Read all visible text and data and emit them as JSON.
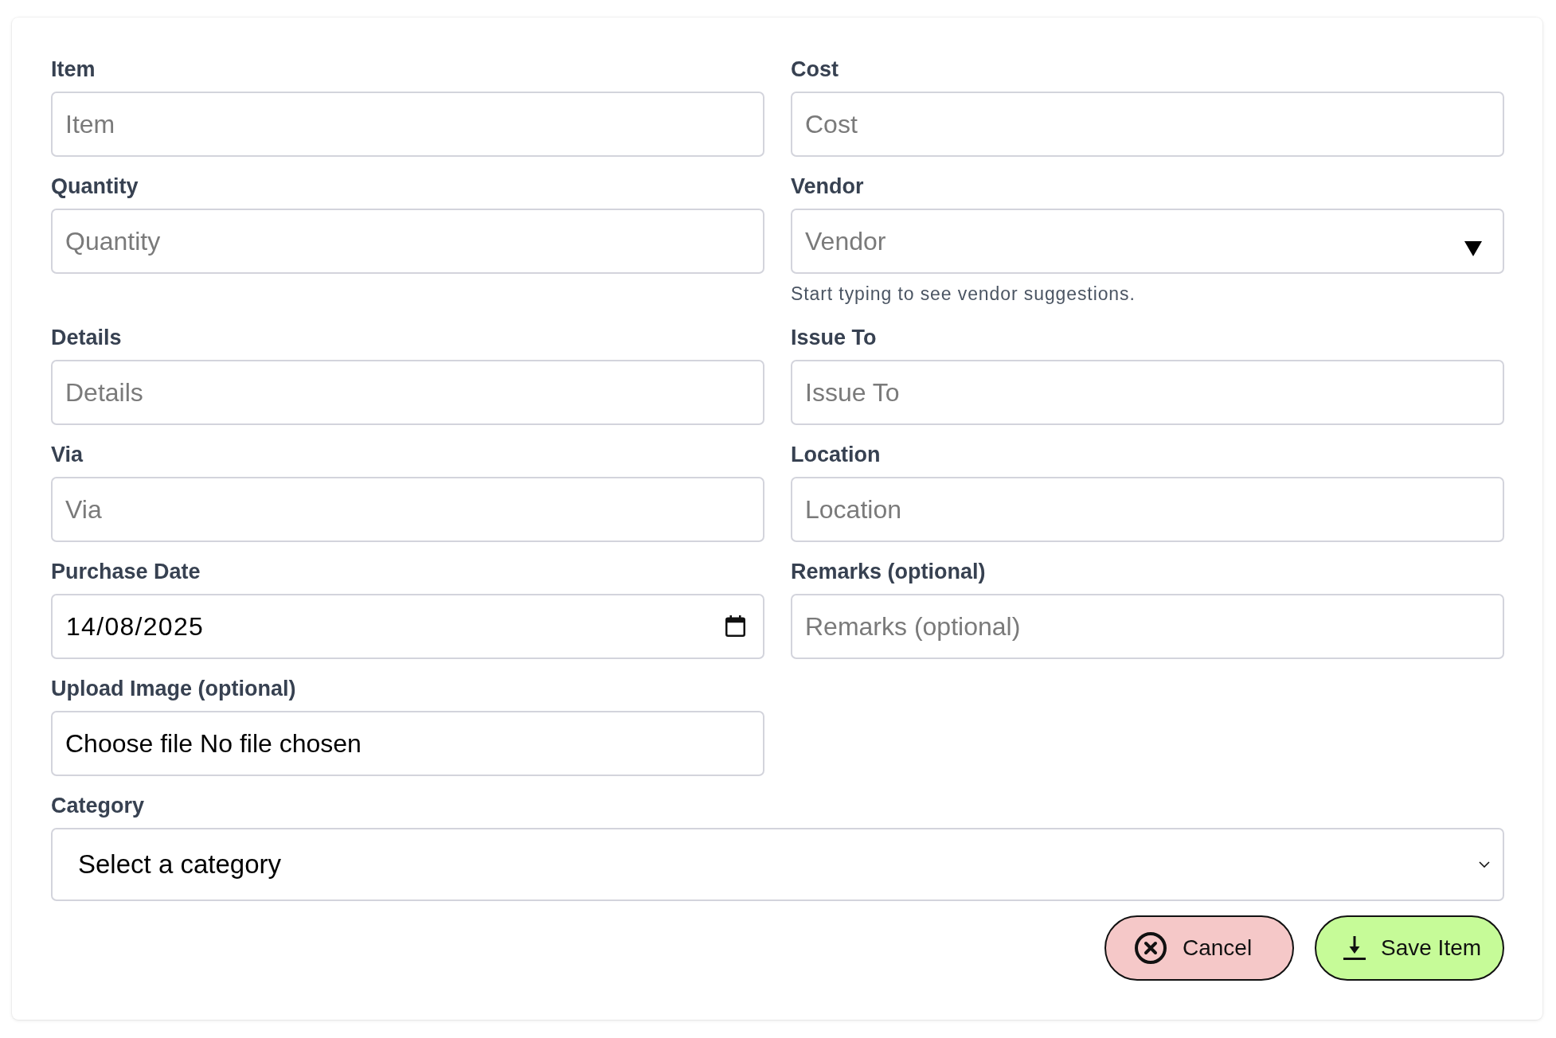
{
  "form": {
    "fields": [
      {
        "kind": "text",
        "label": "Item",
        "placeholder": "Item"
      },
      {
        "kind": "text",
        "label": "Cost",
        "placeholder": "Cost"
      },
      {
        "kind": "text",
        "label": "Quantity",
        "placeholder": "Quantity"
      },
      {
        "kind": "suggest",
        "label": "Vendor",
        "placeholder": "Vendor",
        "hint": "Start typing to see vendor suggestions."
      },
      {
        "kind": "text",
        "label": "Details",
        "placeholder": "Details"
      },
      {
        "kind": "text",
        "label": "Issue To",
        "placeholder": "Issue To"
      },
      {
        "kind": "text",
        "label": "Via",
        "placeholder": "Via"
      },
      {
        "kind": "text",
        "label": "Location",
        "placeholder": "Location"
      },
      {
        "kind": "date",
        "label": "Purchase Date",
        "value": "14/08/2025"
      },
      {
        "kind": "text",
        "label": "Remarks (optional)",
        "placeholder": "Remarks (optional)"
      },
      {
        "kind": "file",
        "label": "Upload Image (optional)",
        "button": "Choose file",
        "status": "No file chosen"
      },
      {
        "kind": "select",
        "label": "Category",
        "value": "Select a category"
      }
    ]
  },
  "buttons": [
    {
      "kind": "cancel",
      "label": "Cancel"
    },
    {
      "kind": "save",
      "label": "Save Item"
    }
  ]
}
